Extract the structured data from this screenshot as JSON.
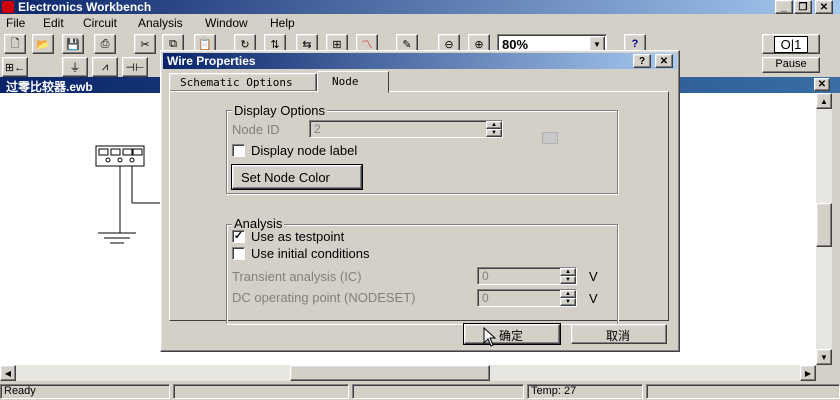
{
  "app": {
    "title": "Electronics Workbench",
    "menu": [
      "File",
      "Edit",
      "Circuit",
      "Analysis",
      "Window",
      "Help"
    ],
    "zoom": "80%",
    "pause_label": "Pause",
    "power_label": "O|1"
  },
  "document": {
    "title": "过零比较器.ewb"
  },
  "dialog": {
    "title": "Wire Properties",
    "tabs": [
      "Schematic Options",
      "Node"
    ],
    "display_options": {
      "group_label": "Display Options",
      "node_id_label": "Node ID",
      "node_id_value": "2",
      "display_node_label": "Display node label",
      "set_node_color": "Set Node Color"
    },
    "analysis": {
      "group_label": "Analysis",
      "use_as_testpoint": "Use as testpoint",
      "use_as_testpoint_checked": true,
      "use_initial_conditions": "Use initial conditions",
      "transient_label": "Transient analysis (IC)",
      "transient_value": "0",
      "transient_unit": "V",
      "dc_label": "DC operating point (NODESET)",
      "dc_value": "0",
      "dc_unit": "V"
    },
    "ok_label": "确定",
    "cancel_label": "取消"
  },
  "status": {
    "ready": "Ready",
    "temp": "Temp:  27"
  }
}
